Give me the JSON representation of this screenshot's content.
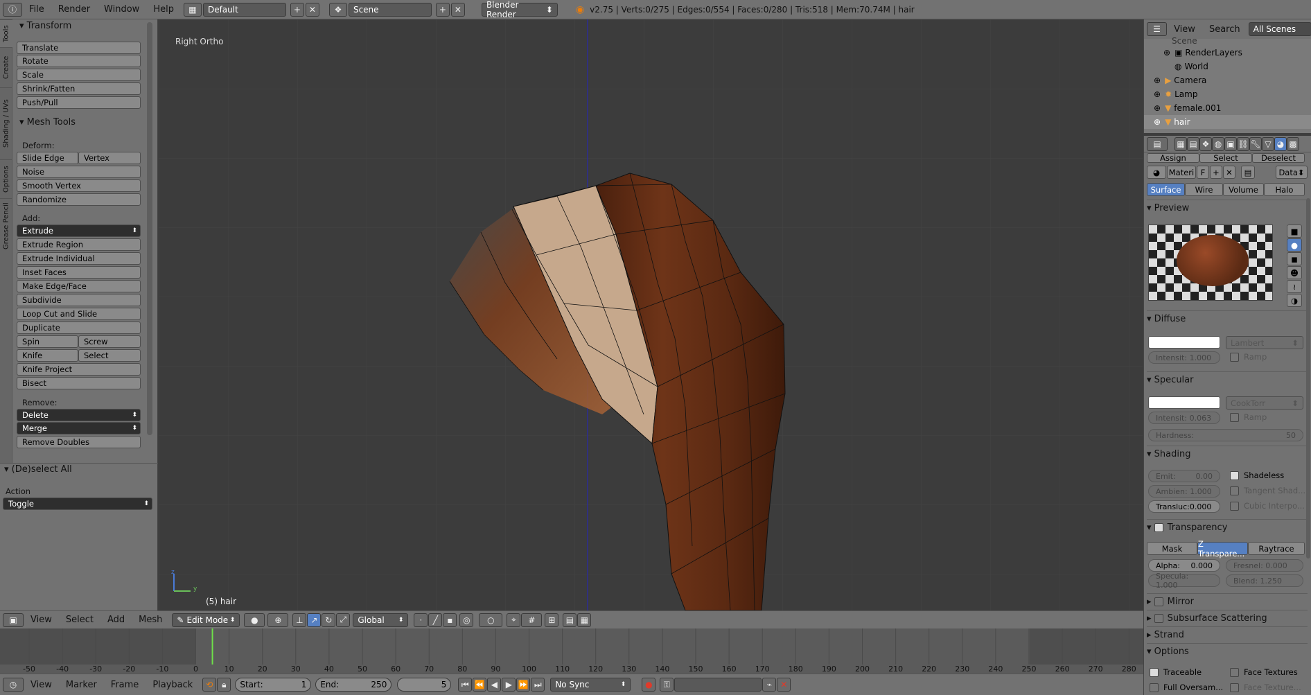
{
  "topbar": {
    "menus": [
      "File",
      "Render",
      "Window",
      "Help"
    ],
    "layout": "Default",
    "scene": "Scene",
    "engine": "Blender Render",
    "stats": "v2.75 | Verts:0/275 | Edges:0/554 | Faces:0/280 | Tris:518 | Mem:70.74M | hair"
  },
  "tools": {
    "vtabs": [
      "Tools",
      "Create",
      "Shading / UVs",
      "Options",
      "Grease Pencil"
    ],
    "transform_title": "Transform",
    "transform": [
      "Translate",
      "Rotate",
      "Scale",
      "Shrink/Fatten",
      "Push/Pull"
    ],
    "mesh_tools_title": "Mesh Tools",
    "deform_label": "Deform:",
    "slide_edge": "Slide Edge",
    "vertex": "Vertex",
    "noise": "Noise",
    "smooth_vertex": "Smooth Vertex",
    "randomize": "Randomize",
    "add_label": "Add:",
    "extrude": "Extrude",
    "extrude_region": "Extrude Region",
    "extrude_individual": "Extrude Individual",
    "inset_faces": "Inset Faces",
    "make_edge_face": "Make Edge/Face",
    "subdivide": "Subdivide",
    "loop_cut": "Loop Cut and Slide",
    "duplicate": "Duplicate",
    "spin": "Spin",
    "screw": "Screw",
    "knife": "Knife",
    "select": "Select",
    "knife_project": "Knife Project",
    "bisect": "Bisect",
    "remove_label": "Remove:",
    "delete": "Delete",
    "merge": "Merge",
    "remove_doubles": "Remove Doubles",
    "operator_title": "(De)select All",
    "action_label": "Action",
    "action_value": "Toggle"
  },
  "viewport": {
    "view_name": "Right Ortho",
    "object_label": "(5) hair"
  },
  "view3d_header": {
    "menus": [
      "View",
      "Select",
      "Add",
      "Mesh"
    ],
    "mode": "Edit Mode",
    "orientation": "Global"
  },
  "timeline": {
    "ticks": [
      "-50",
      "-40",
      "-30",
      "-20",
      "-10",
      "0",
      "10",
      "20",
      "30",
      "40",
      "50",
      "60",
      "70",
      "80",
      "90",
      "100",
      "110",
      "120",
      "130",
      "140",
      "150",
      "160",
      "170",
      "180",
      "190",
      "200",
      "210",
      "220",
      "230",
      "240",
      "250",
      "260",
      "270",
      "280"
    ],
    "menus": [
      "View",
      "Marker",
      "Frame",
      "Playback"
    ],
    "start_label": "Start:",
    "start_value": "1",
    "end_label": "End:",
    "end_value": "250",
    "current": "5",
    "sync": "No Sync",
    "current_frame": 5
  },
  "outliner": {
    "menus": [
      "View",
      "Search"
    ],
    "scenes": "All Scenes",
    "items": [
      "Scene",
      "RenderLayers",
      "World",
      "Camera",
      "Lamp",
      "female.001",
      "hair"
    ]
  },
  "material": {
    "assign": "Assign",
    "select": "Select",
    "deselect": "Deselect",
    "name": "Materi",
    "fake": "F",
    "data": "Data",
    "tabs": [
      "Surface",
      "Wire",
      "Volume",
      "Halo"
    ],
    "preview_title": "Preview",
    "diffuse_title": "Diffuse",
    "diffuse_shader": "Lambert",
    "diffuse_intensity": "Intensit: 1.000",
    "ramp": "Ramp",
    "specular_title": "Specular",
    "specular_shader": "CookTorr",
    "specular_intensity": "Intensit: 0.063",
    "hardness_label": "Hardness:",
    "hardness_value": "50",
    "shading_title": "Shading",
    "emit_label": "Emit:",
    "emit_value": "0.00",
    "shadeless": "Shadeless",
    "ambient": "Ambien: 1.000",
    "tangent": "Tangent Shad...",
    "transluc": "Transluc:0.000",
    "cubic": "Cubic Interpo...",
    "transparency_title": "Transparency",
    "trans_tabs": [
      "Mask",
      "Z Transpare...",
      "Raytrace"
    ],
    "alpha_label": "Alpha:",
    "alpha_value": "0.000",
    "fresnel": "Fresnel: 0.000",
    "specula": "Specula: 1.000",
    "blend": "Blend:   1.250",
    "mirror": "Mirror",
    "sss": "Subsurface Scattering",
    "strand": "Strand",
    "options_title": "Options",
    "traceable": "Traceable",
    "face_textures": "Face Textures",
    "full_oversam": "Full Oversam...",
    "face_texture": "Face Texture..."
  },
  "colors": {
    "panel": "#727272",
    "viewport": "#3c3c3c",
    "accent": "#5680c2",
    "hair_dark": "#5a2a14",
    "hair_light": "#c6a88c"
  }
}
